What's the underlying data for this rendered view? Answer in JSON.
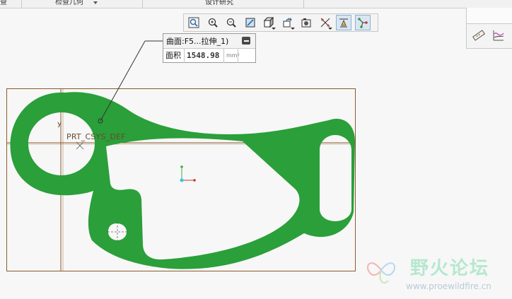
{
  "ribbon": {
    "tabs": [
      "检查几何",
      "设计研究"
    ],
    "edge_label": "查"
  },
  "toolbar": {
    "buttons": [
      {
        "name": "refit-icon"
      },
      {
        "name": "zoom-in-icon"
      },
      {
        "name": "zoom-out-icon"
      },
      {
        "name": "repaint-icon"
      },
      {
        "name": "display-style-icon"
      },
      {
        "name": "saved-orientations-icon"
      },
      {
        "name": "view-manager-icon"
      },
      {
        "name": "datum-display-icon"
      },
      {
        "name": "annotation-display-icon",
        "active": true
      },
      {
        "name": "spin-center-icon",
        "active": true
      }
    ]
  },
  "side_panel": {
    "buttons": [
      {
        "name": "measure-icon"
      },
      {
        "name": "analysis-graph-icon"
      }
    ]
  },
  "measure": {
    "title": "曲面:F5...拉伸_1)",
    "area_label": "面积",
    "area_value": "1548.98",
    "unit": "mm²"
  },
  "model": {
    "csys_label": "PRT_CSYS_DEF",
    "axis_label_y": "y",
    "color": "#2a9f3a",
    "frame_color": "#8b5a2b"
  },
  "watermark": {
    "title": "野火论坛",
    "url": "www.proewildfire.cn"
  }
}
